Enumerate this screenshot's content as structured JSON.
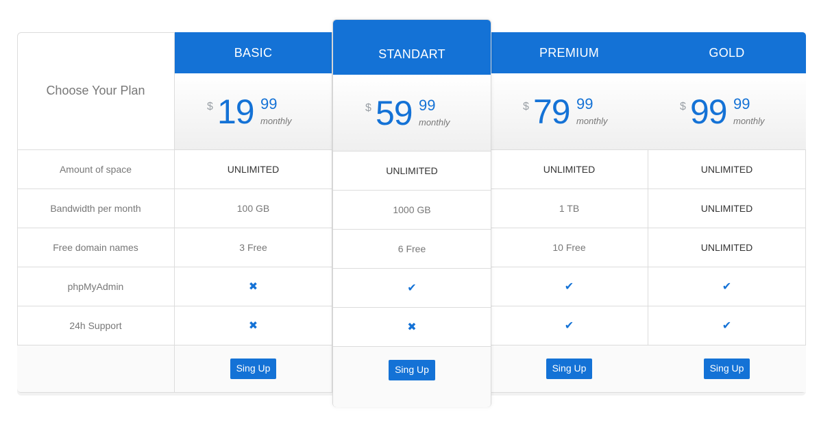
{
  "header": {
    "choose_label": "Choose Your Plan"
  },
  "features": [
    "Amount of space",
    "Bandwidth per month",
    "Free domain names",
    "phpMyAdmin",
    "24h Support"
  ],
  "plans": [
    {
      "name": "BASIC",
      "currency": "$",
      "price": "19",
      "cents": "99",
      "period": "monthly",
      "values": [
        "UNLIMITED",
        "100 GB",
        "3 Free",
        "no",
        "no"
      ],
      "button": "Sing Up"
    },
    {
      "name": "STANDART",
      "currency": "$",
      "price": "59",
      "cents": "99",
      "period": "monthly",
      "values": [
        "UNLIMITED",
        "1000 GB",
        "6 Free",
        "yes",
        "no"
      ],
      "button": "Sing Up"
    },
    {
      "name": "PREMIUM",
      "currency": "$",
      "price": "79",
      "cents": "99",
      "period": "monthly",
      "values": [
        "UNLIMITED",
        "1 TB",
        "10 Free",
        "yes",
        "yes"
      ],
      "button": "Sing Up"
    },
    {
      "name": "GOLD",
      "currency": "$",
      "price": "99",
      "cents": "99",
      "period": "monthly",
      "values": [
        "UNLIMITED",
        "UNLIMITED",
        "UNLIMITED",
        "yes",
        "yes"
      ],
      "button": "Sing Up"
    }
  ],
  "icons": {
    "yes": "check-icon",
    "no": "cross-icon"
  },
  "colors": {
    "accent": "#1472d6",
    "border": "#dcdcdc",
    "muted_text": "#777777"
  }
}
